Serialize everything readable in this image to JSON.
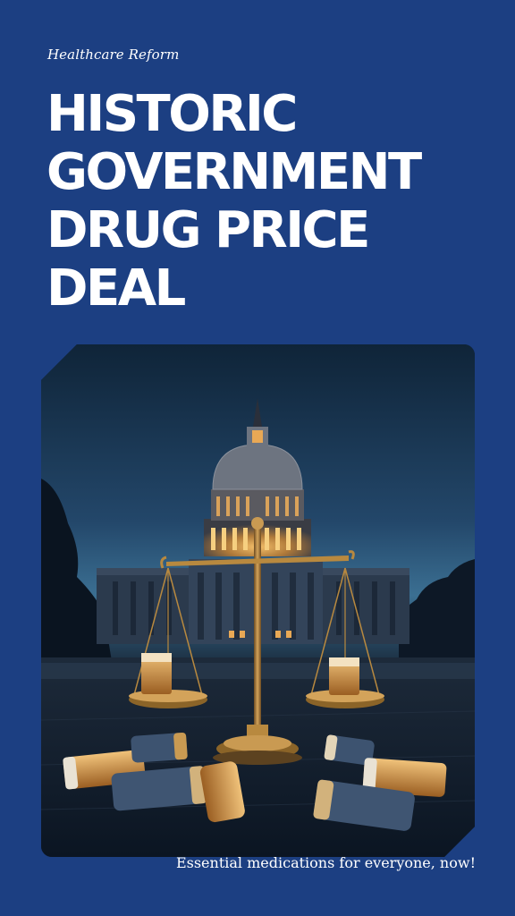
{
  "kicker": "Healthcare Reform",
  "headline": {
    "line1": "HISTORIC",
    "line2": "GOVERNMENT",
    "line3": "DRUG PRICE",
    "line4": "DEAL"
  },
  "tagline": "Essential medications for everyone, now!",
  "colors": {
    "background": "#1c3f82",
    "text": "#ffffff",
    "dome_glow": "#e8a855",
    "brass": "#b8893f"
  },
  "image": {
    "description_icon": "capitol-scale-pills-photo"
  }
}
